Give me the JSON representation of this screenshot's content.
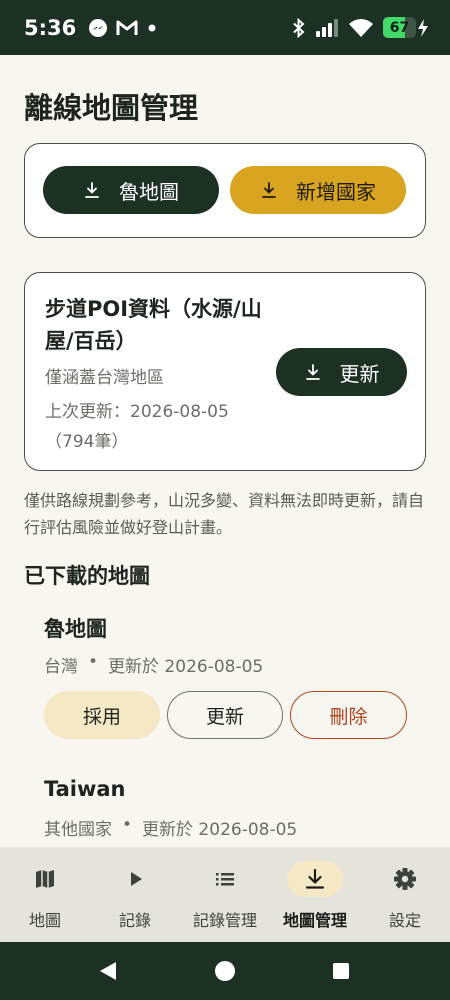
{
  "status_bar": {
    "time": "5:36",
    "battery_level": 67,
    "battery_label": "67",
    "left_icons": [
      "messenger-icon",
      "gmail-icon",
      "notification-dot-icon"
    ],
    "right_icons": [
      "bluetooth-icon",
      "cell-signal-icon",
      "wifi-icon",
      "battery-icon",
      "charging-bolt-icon"
    ]
  },
  "page": {
    "title": "離線地圖管理"
  },
  "actions": {
    "download_rudymap": "魯地圖",
    "add_country": "新增國家"
  },
  "poi": {
    "title": "步道POI資料（水源/山屋/百岳）",
    "coverage": "僅涵蓋台灣地區",
    "last_updated": "上次更新：2026-08-05（794筆）",
    "update_button": "更新"
  },
  "disclaimer": "僅供路線規劃參考，山況多變、資料無法即時更新，請自行評估風險並做好登山計畫。",
  "downloaded": {
    "section_title": "已下載的地圖",
    "maps": [
      {
        "name": "魯地圖",
        "region": "台灣",
        "separator": "•",
        "updated": "更新於 2026-08-05",
        "apply_label": "採用",
        "update_label": "更新",
        "delete_label": "刪除"
      },
      {
        "name": "Taiwan",
        "region": "其他國家",
        "separator": "•",
        "updated": "更新於 2026-08-05"
      }
    ]
  },
  "bottom_nav": {
    "items": [
      {
        "label": "地圖",
        "icon": "map-icon"
      },
      {
        "label": "記錄",
        "icon": "play-icon"
      },
      {
        "label": "記錄管理",
        "icon": "list-icon"
      },
      {
        "label": "地圖管理",
        "icon": "download-icon",
        "active": true
      },
      {
        "label": "設定",
        "icon": "gear-icon"
      }
    ]
  },
  "colors": {
    "primary_dark": "#1d3024",
    "accent_gold": "#d9a520",
    "danger": "#b1461c",
    "background": "#f8f6f1",
    "battery_green": "#41d96a"
  }
}
